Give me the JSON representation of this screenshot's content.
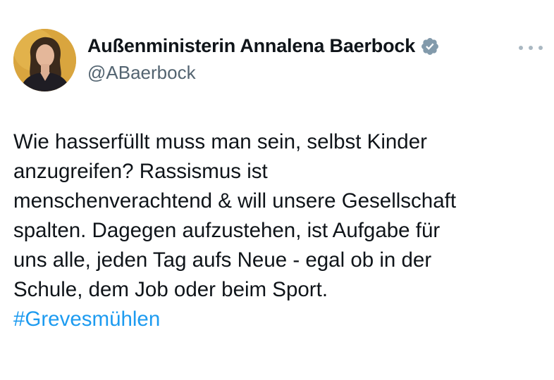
{
  "author": {
    "display_name": "Außenministerin Annalena Baerbock",
    "handle": "@ABaerbock",
    "verified_icon": "verified-badge-icon",
    "verified_color": "#829aab"
  },
  "menu": {
    "icon": "more-options-icon"
  },
  "tweet": {
    "lines": [
      "Wie hasserfüllt muss man sein, selbst Kinder",
      "anzugreifen? Rassismus ist",
      "menschenverachtend & will unsere Gesellschaft",
      "spalten. Dagegen aufzustehen, ist Aufgabe für",
      "uns alle, jeden Tag aufs Neue - egal ob in der",
      "Schule, dem Job oder beim Sport."
    ],
    "hashtag": "#Grevesmühlen"
  },
  "colors": {
    "text": "#0f1419",
    "secondary": "#536471",
    "link": "#1d9bf0",
    "avatar_background": "#d8a13a"
  }
}
